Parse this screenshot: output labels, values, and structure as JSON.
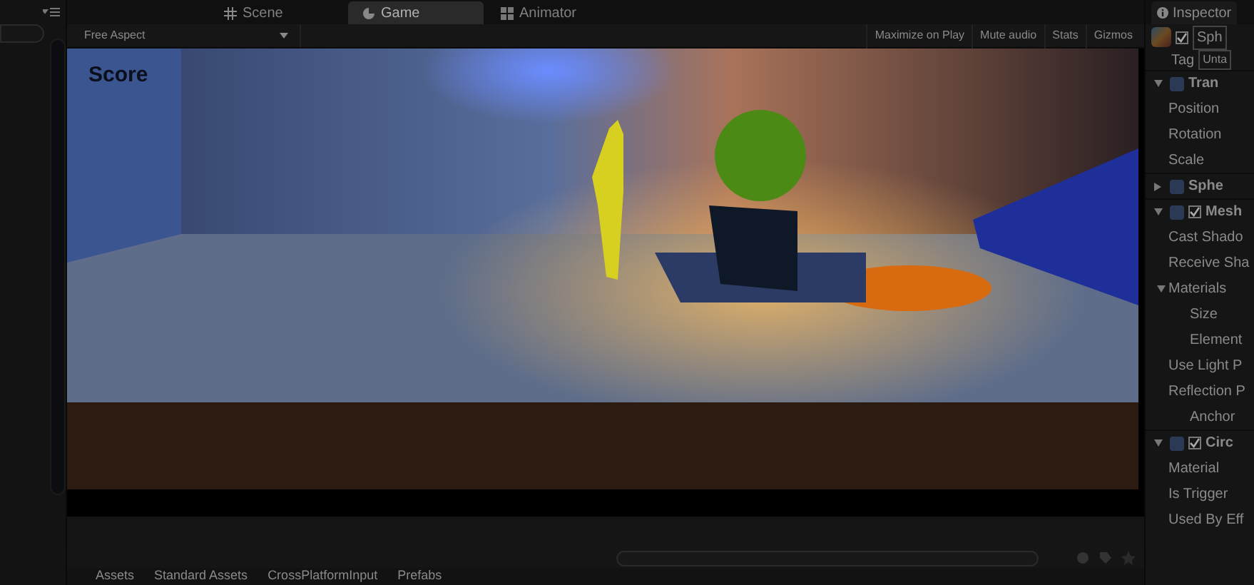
{
  "tabs": [
    {
      "label": "Scene",
      "selected": false
    },
    {
      "label": "Game",
      "selected": true
    },
    {
      "label": "Animator",
      "selected": false
    }
  ],
  "game_toolbar": {
    "aspect": "Free Aspect",
    "buttons": [
      "Maximize on Play",
      "Mute audio",
      "Stats",
      "Gizmos"
    ]
  },
  "game_view": {
    "score_label": "Score"
  },
  "inspector": {
    "tab": "Inspector",
    "object_active": true,
    "object_name": "Sph",
    "tag_label": "Tag",
    "tag_value": "Unta",
    "components": [
      {
        "title": "Tran",
        "kind": "plain",
        "expanded": true,
        "properties": [
          {
            "label": "Position"
          },
          {
            "label": "Rotation"
          },
          {
            "label": "Scale"
          }
        ]
      },
      {
        "title": "Sphe",
        "kind": "plain",
        "expanded": false
      },
      {
        "title": "Mesh",
        "kind": "toggle",
        "checked": true,
        "expanded": true,
        "properties": [
          {
            "label": "Cast Shado"
          },
          {
            "label": "Receive Sha"
          },
          {
            "label": "Materials",
            "expanded": true,
            "children": [
              {
                "label": "Size"
              },
              {
                "label": "Element"
              }
            ]
          },
          {
            "label": "Use Light P"
          },
          {
            "label": "Reflection P",
            "children": [
              {
                "label": "Anchor"
              }
            ]
          }
        ]
      },
      {
        "title": "Circ",
        "kind": "toggle",
        "checked": true,
        "expanded": true,
        "properties": [
          {
            "label": "Material"
          },
          {
            "label": "Is Trigger"
          },
          {
            "label": "Used By Eff"
          }
        ]
      }
    ]
  },
  "project": {
    "breadcrumb": [
      "Assets",
      "Standard Assets",
      "CrossPlatformInput",
      "Prefabs"
    ]
  }
}
